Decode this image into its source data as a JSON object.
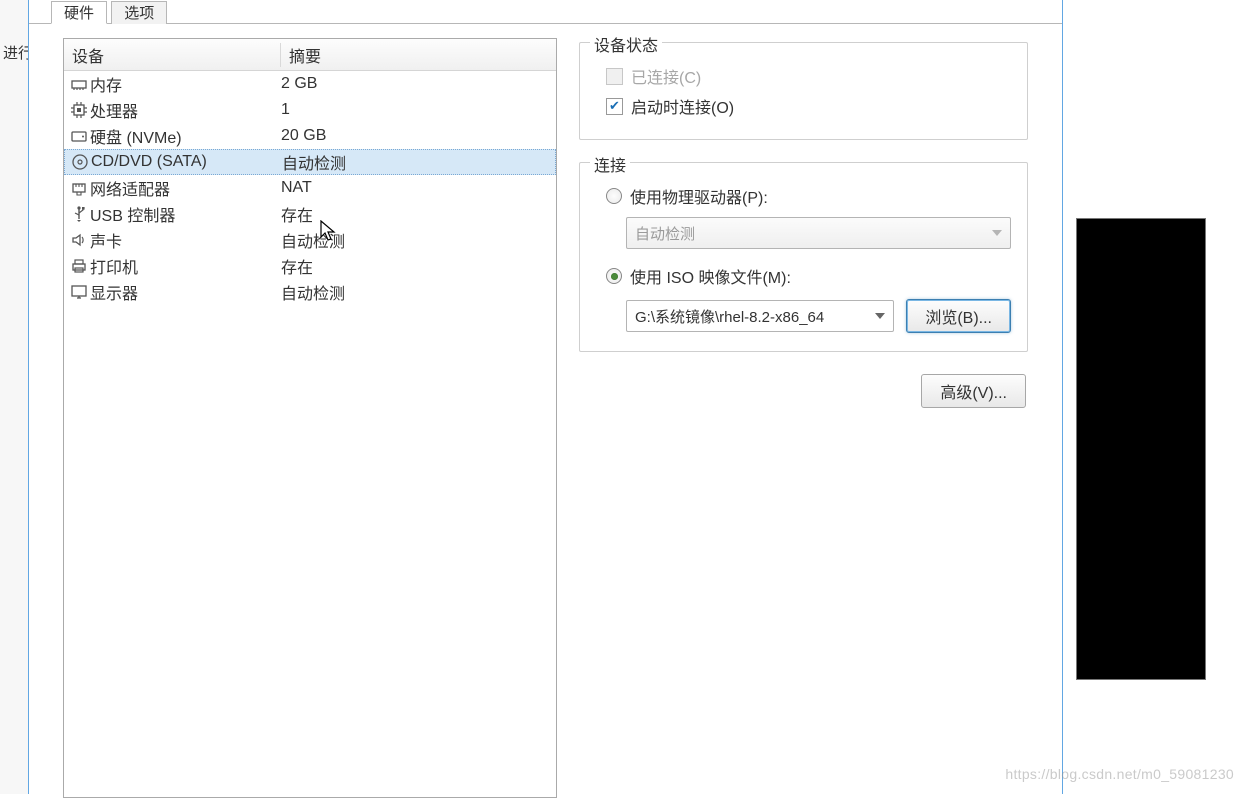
{
  "bg_left_text": "进行",
  "tabs": {
    "hardware": "硬件",
    "options": "选项"
  },
  "headers": {
    "device": "设备",
    "summary": "摘要"
  },
  "devices": [
    {
      "icon": "memory",
      "name": "内存",
      "summary": "2 GB",
      "selected": false
    },
    {
      "icon": "cpu",
      "name": "处理器",
      "summary": "1",
      "selected": false
    },
    {
      "icon": "disk",
      "name": "硬盘 (NVMe)",
      "summary": "20 GB",
      "selected": false
    },
    {
      "icon": "disc",
      "name": "CD/DVD (SATA)",
      "summary": "自动检测",
      "selected": true
    },
    {
      "icon": "net",
      "name": "网络适配器",
      "summary": "NAT",
      "selected": false
    },
    {
      "icon": "usb",
      "name": "USB 控制器",
      "summary": "存在",
      "selected": false
    },
    {
      "icon": "sound",
      "name": "声卡",
      "summary": "自动检测",
      "selected": false
    },
    {
      "icon": "printer",
      "name": "打印机",
      "summary": "存在",
      "selected": false
    },
    {
      "icon": "display",
      "name": "显示器",
      "summary": "自动检测",
      "selected": false
    }
  ],
  "status": {
    "title": "设备状态",
    "connected": "已连接(C)",
    "connect_on_power": "启动时连接(O)"
  },
  "connection": {
    "title": "连接",
    "use_physical": "使用物理驱动器(P):",
    "auto_detect": "自动检测",
    "use_iso": "使用 ISO 映像文件(M):",
    "iso_path": "G:\\系统镜像\\rhel-8.2-x86_64",
    "browse": "浏览(B)..."
  },
  "advanced": "高级(V)...",
  "watermark": "https://blog.csdn.net/m0_59081230"
}
